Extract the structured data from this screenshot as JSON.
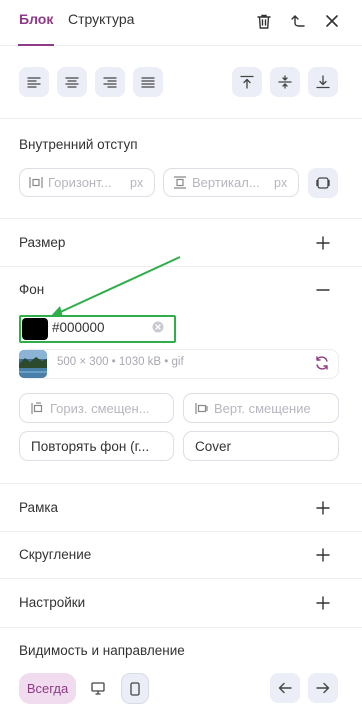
{
  "tabs": {
    "block": "Блок",
    "structure": "Структура"
  },
  "header_icons": {
    "delete": "trash-icon",
    "parent": "level-up-icon",
    "close": "close-icon"
  },
  "align_buttons": [
    "align-left-icon",
    "align-center-icon",
    "align-right-icon",
    "align-justify-icon"
  ],
  "valign_buttons": [
    "align-top-icon",
    "align-middle-icon",
    "align-bottom-icon"
  ],
  "padding": {
    "title": "Внутренний отступ",
    "horizontal_placeholder": "Горизонт...",
    "horizontal_unit": "px",
    "vertical_placeholder": "Вертикал...",
    "vertical_unit": "px"
  },
  "size": {
    "title": "Размер"
  },
  "background": {
    "title": "Фон",
    "color_value": "#000000",
    "color_swatch": "#000000",
    "image_meta": "500 × 300  •  1030 kB  •  gif",
    "h_offset_placeholder": "Гориз. смещен...",
    "v_offset_placeholder": "Верт. смещение",
    "repeat_value": "Повторять фон (г...",
    "size_value": "Cover"
  },
  "border": {
    "title": "Рамка"
  },
  "rounding": {
    "title": "Скругление"
  },
  "settings": {
    "title": "Настройки"
  },
  "visibility": {
    "title": "Видимость и направление",
    "always_label": "Всегда"
  },
  "colors": {
    "accent": "#8e3a86",
    "highlight": "#2fae4a",
    "button_bg": "#eceef7",
    "pill_bg": "#f0dcee"
  }
}
